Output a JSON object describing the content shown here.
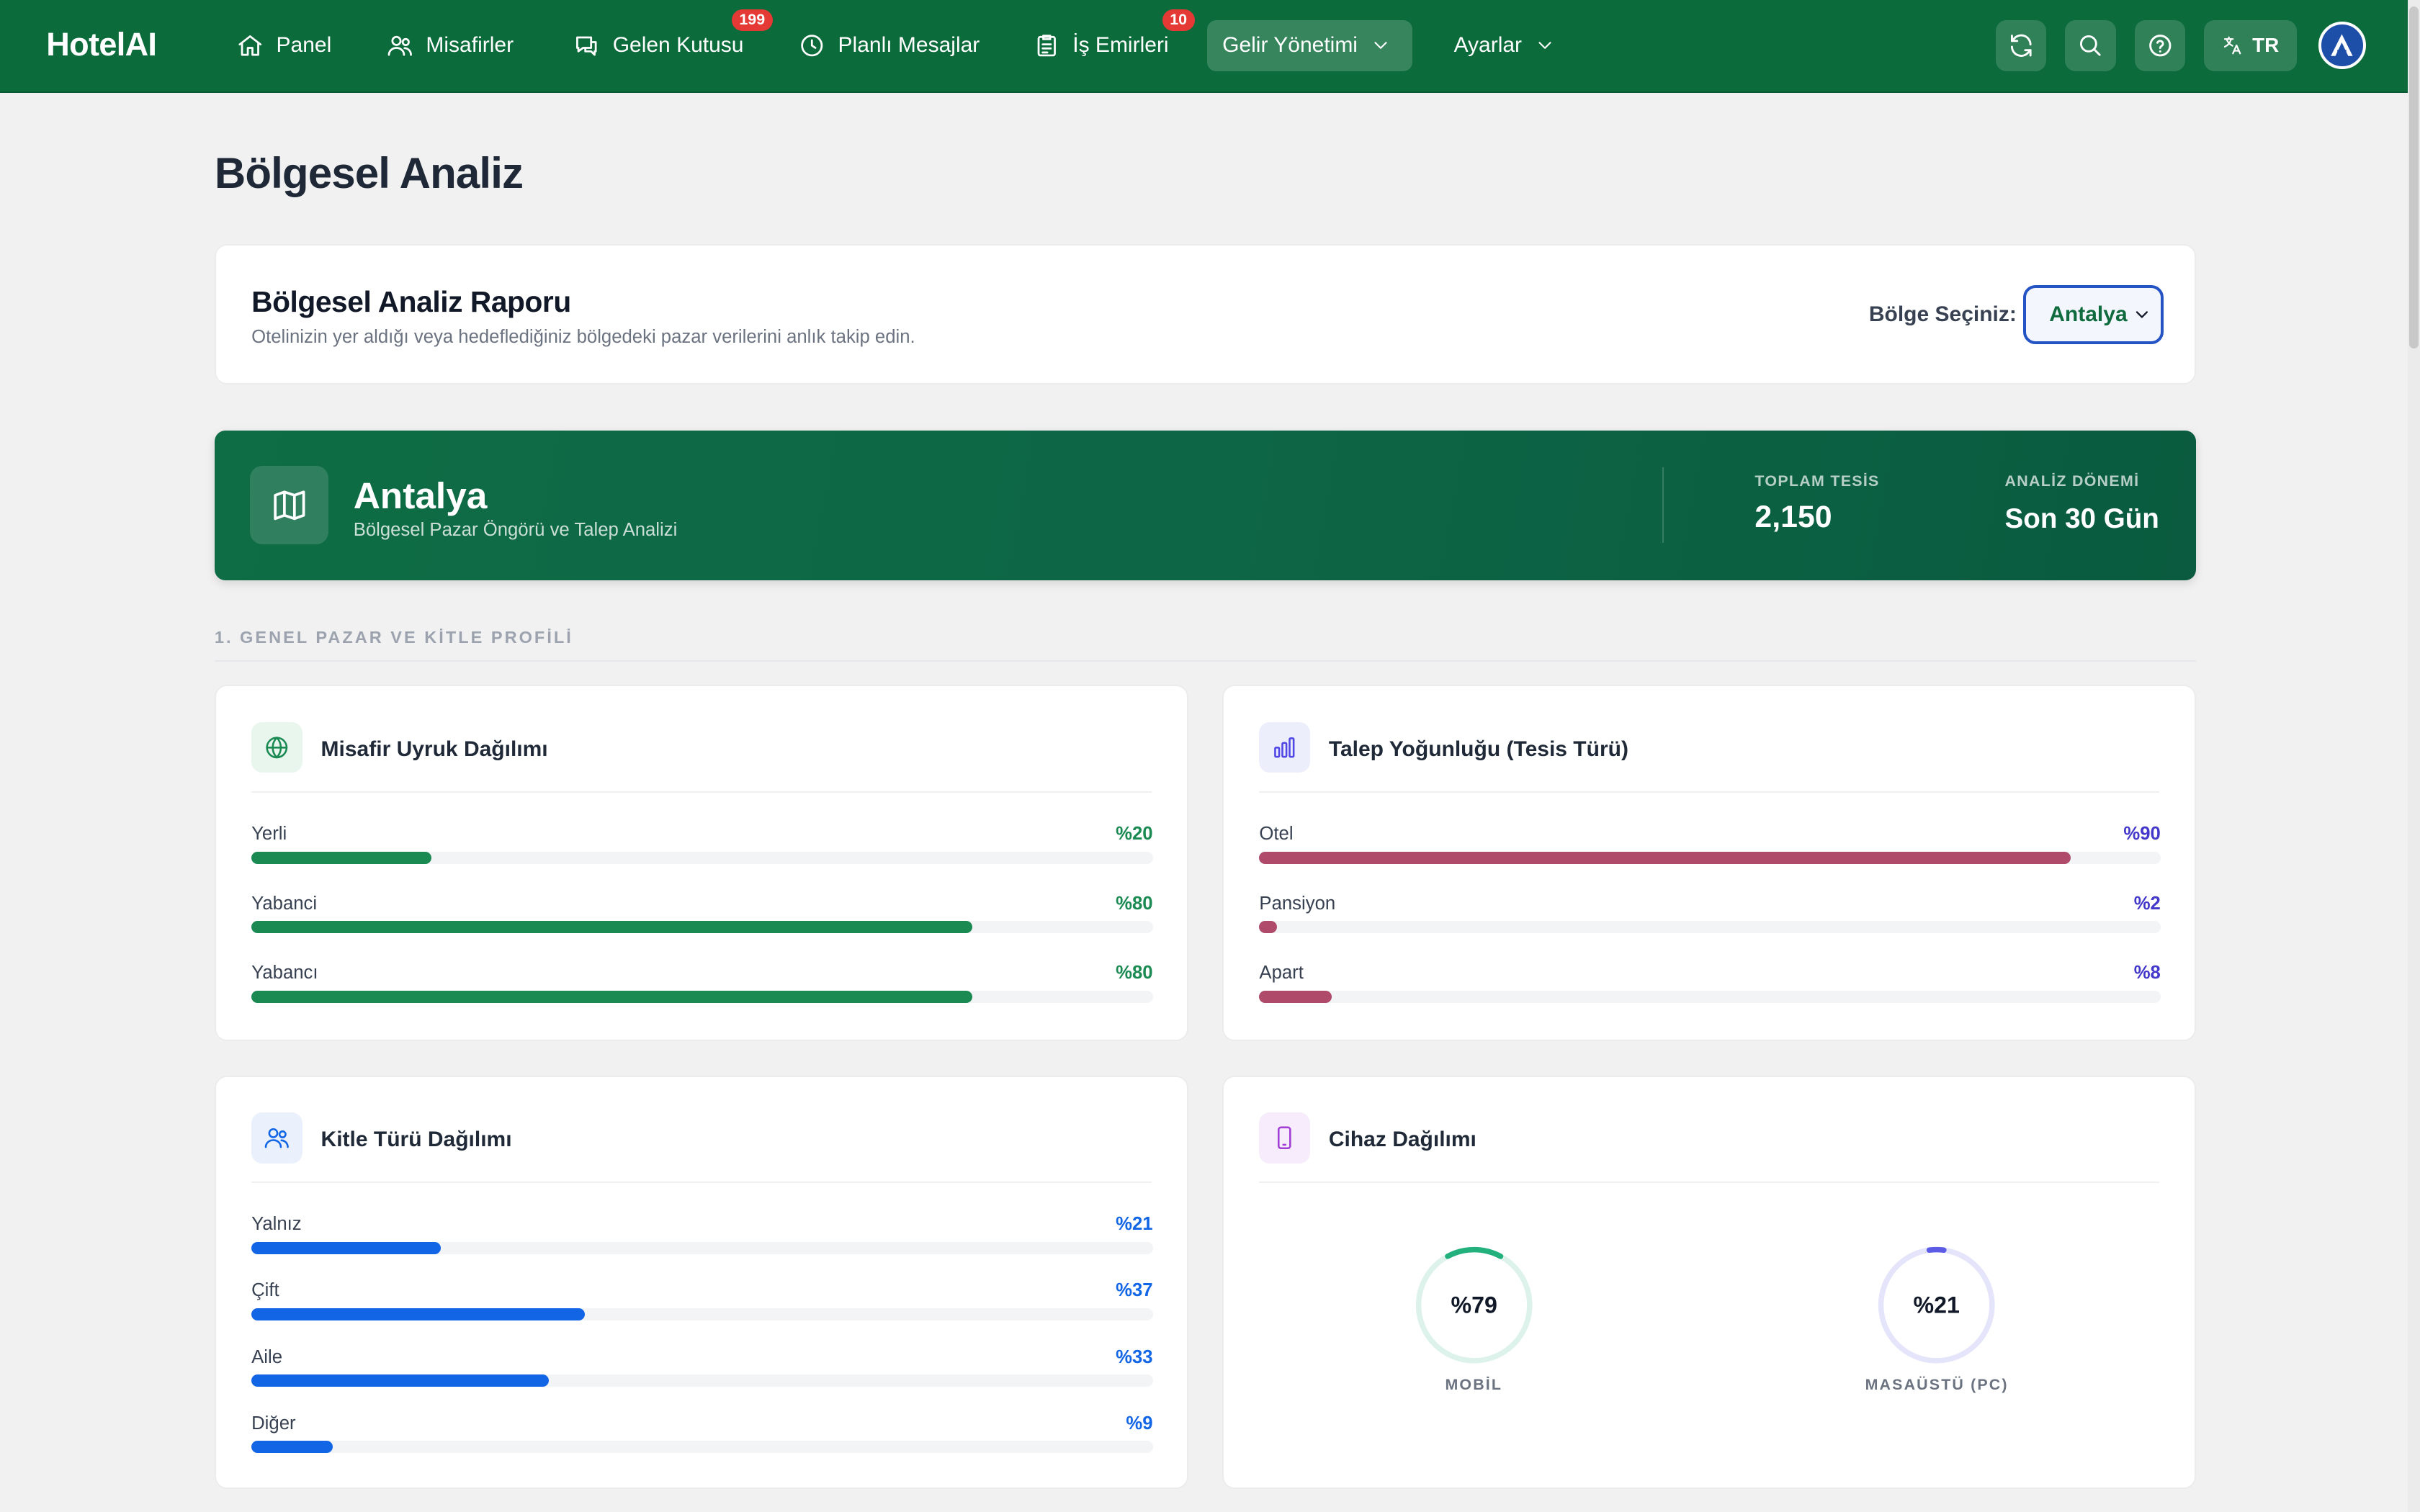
{
  "nav": {
    "brand": "HotelAI",
    "items": [
      {
        "label": "Panel"
      },
      {
        "label": "Misafirler"
      },
      {
        "label": "Gelen Kutusu",
        "badge": "199"
      },
      {
        "label": "Planlı Mesajlar"
      },
      {
        "label": "İş Emirleri",
        "badge": "10"
      },
      {
        "label": "Gelir Yönetimi"
      },
      {
        "label": "Ayarlar"
      }
    ],
    "language": "TR"
  },
  "page": {
    "title": "Bölgesel Analiz"
  },
  "report": {
    "title": "Bölgesel Analiz Raporu",
    "subtitle": "Otelinizin yer aldığı veya hedeflediğiniz bölgedeki pazar verilerini anlık takip edin.",
    "region_label": "Bölge Seçiniz:",
    "region_value": "Antalya"
  },
  "hero": {
    "city": "Antalya",
    "subtitle": "Bölgesel Pazar Öngörü ve Talep Analizi",
    "stats": [
      {
        "label": "TOPLAM TESİS",
        "value": "2,150"
      },
      {
        "label": "ANALİZ DÖNEMİ",
        "value": "Son 30 Gün"
      }
    ]
  },
  "section1": {
    "title": "1. GENEL PAZAR VE KİTLE PROFİLİ"
  },
  "nationality": {
    "title": "Misafir Uyruk Dağılımı",
    "color": "#1a8a52",
    "rows": [
      {
        "label": "Yerli",
        "value_text": "%20",
        "percent": 20
      },
      {
        "label": "Yabanci",
        "value_text": "%80",
        "percent": 80
      },
      {
        "label": "Yabancı",
        "value_text": "%80",
        "percent": 80
      }
    ]
  },
  "demand": {
    "title": "Talep Yoğunluğu (Tesis Türü)",
    "color": "#b04a6a",
    "value_color": "#4338ca",
    "rows": [
      {
        "label": "Otel",
        "value_text": "%90",
        "percent": 90
      },
      {
        "label": "Pansiyon",
        "value_text": "%2",
        "percent": 2
      },
      {
        "label": "Apart",
        "value_text": "%8",
        "percent": 8
      }
    ]
  },
  "audience": {
    "title": "Kitle Türü Dağılımı",
    "color": "#1266e6",
    "rows": [
      {
        "label": "Yalnız",
        "value_text": "%21",
        "percent": 21
      },
      {
        "label": "Çift",
        "value_text": "%37",
        "percent": 37
      },
      {
        "label": "Aile",
        "value_text": "%33",
        "percent": 33
      },
      {
        "label": "Diğer",
        "value_text": "%9",
        "percent": 9
      }
    ]
  },
  "devices": {
    "title": "Cihaz Dağılımı",
    "items": [
      {
        "label": "MOBİL",
        "value_text": "%79",
        "percent": 79,
        "color": "#22b07d",
        "track": "#dcf2ea"
      },
      {
        "label": "MASAÜSTÜ (PC)",
        "value_text": "%21",
        "percent": 21,
        "color": "#5b5be6",
        "track": "#e4e4fb"
      }
    ]
  }
}
